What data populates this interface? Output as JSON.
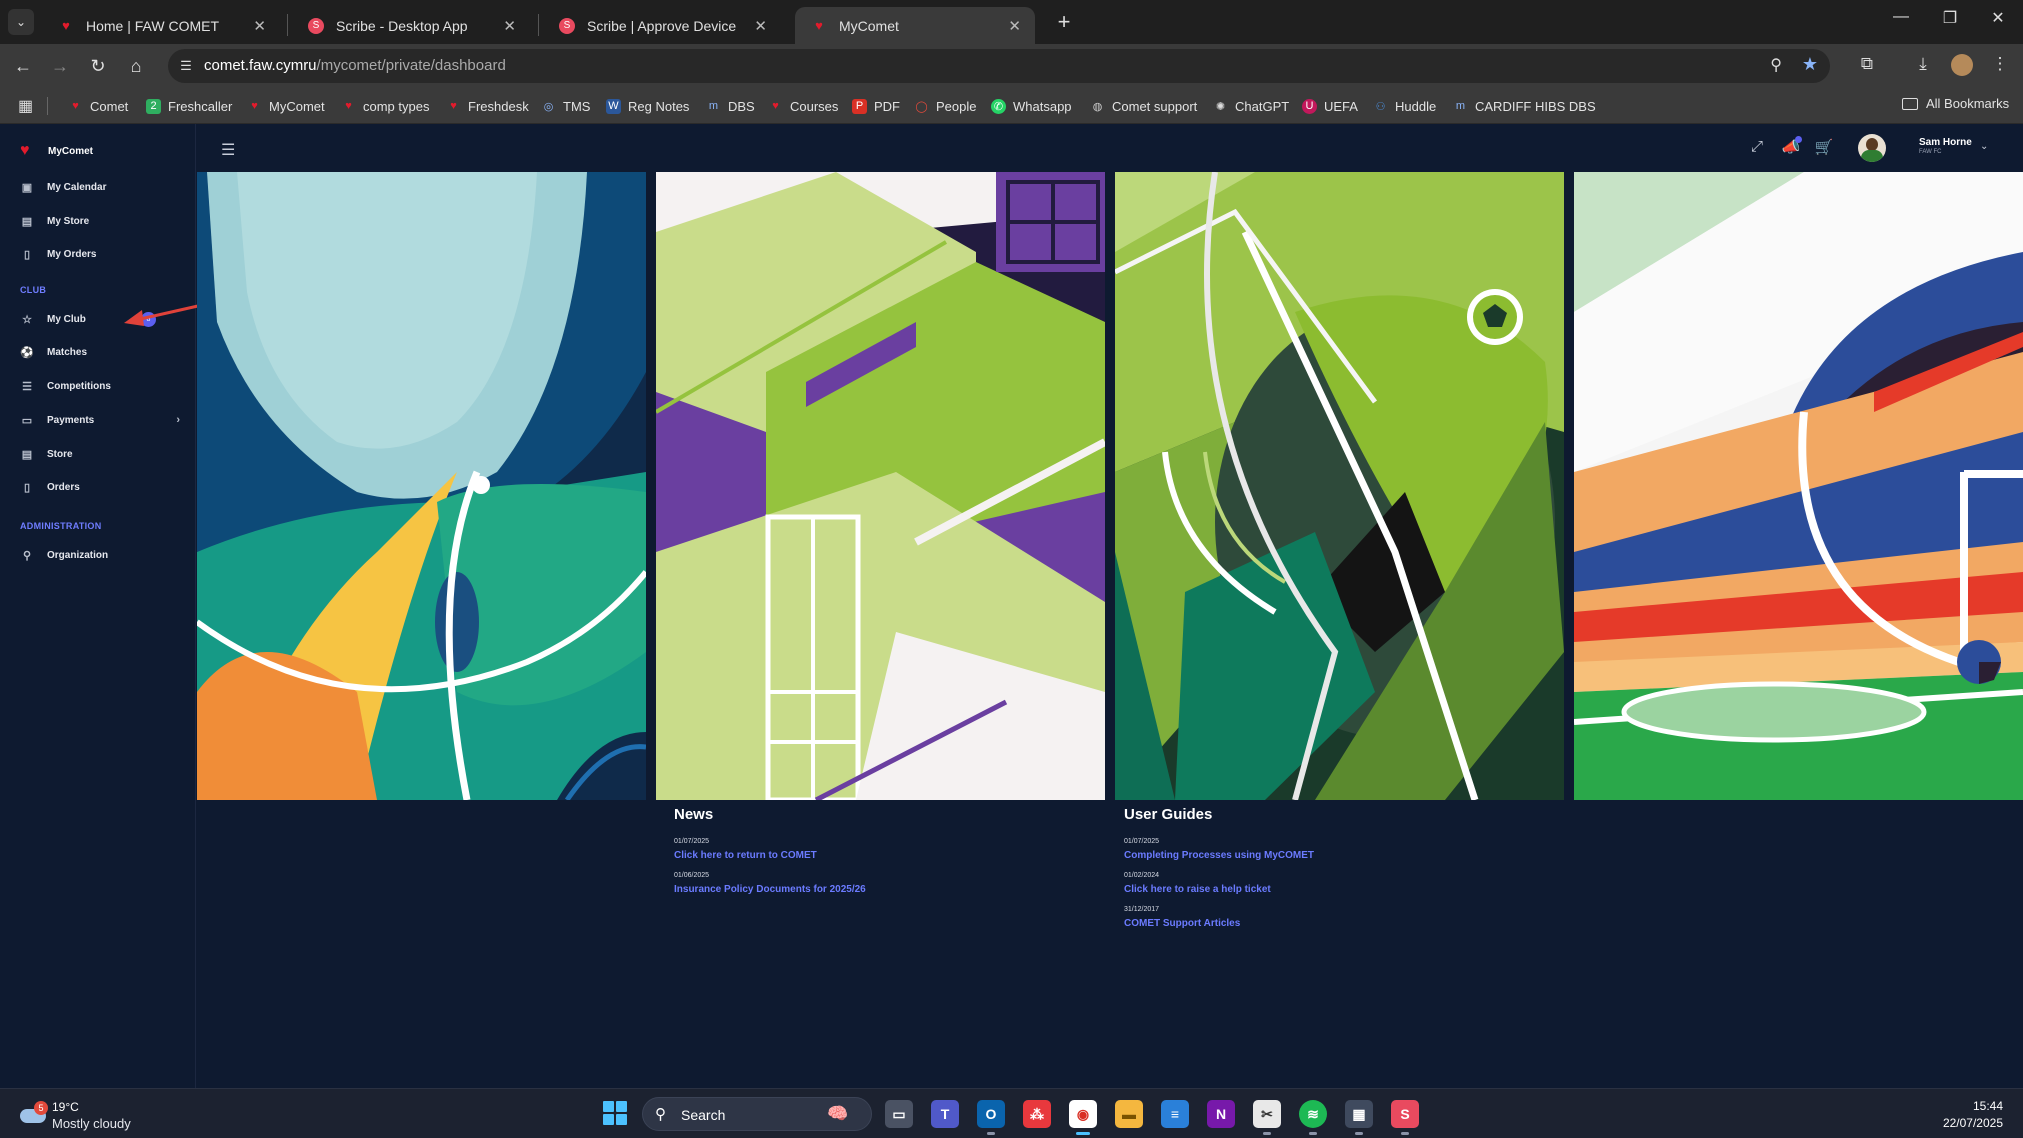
{
  "browser": {
    "tabs": [
      {
        "title": "Home | FAW COMET",
        "active": false
      },
      {
        "title": "Scribe - Desktop App",
        "active": false
      },
      {
        "title": "Scribe | Approve Device",
        "active": false
      },
      {
        "title": "MyComet",
        "active": true
      }
    ],
    "url_host": "comet.faw.cymru",
    "url_path": "/mycomet/private/dashboard",
    "bookmarks": [
      "Comet",
      "Freshcaller",
      "MyComet",
      "comp types",
      "Freshdesk",
      "TMS",
      "Reg Notes",
      "DBS",
      "Courses",
      "PDF",
      "People",
      "Whatsapp",
      "Comet support",
      "ChatGPT",
      "UEFA",
      "Huddle",
      "CARDIFF HIBS DBS"
    ],
    "all_bookmarks": "All Bookmarks"
  },
  "sidebar": {
    "brand": "MyComet",
    "items_top": [
      {
        "label": "My Calendar",
        "icon": "calendar-icon"
      },
      {
        "label": "My Store",
        "icon": "store-icon"
      },
      {
        "label": "My Orders",
        "icon": "document-icon"
      }
    ],
    "section_club": "CLUB",
    "items_club": [
      {
        "label": "My Club",
        "icon": "star-icon",
        "badge": "8"
      },
      {
        "label": "Matches",
        "icon": "football-icon"
      },
      {
        "label": "Competitions",
        "icon": "list-icon"
      },
      {
        "label": "Payments",
        "icon": "card-icon"
      },
      {
        "label": "Store",
        "icon": "store-icon"
      },
      {
        "label": "Orders",
        "icon": "document-icon"
      }
    ],
    "section_admin": "ADMINISTRATION",
    "items_admin": [
      {
        "label": "Organization",
        "icon": "hierarchy-icon"
      }
    ]
  },
  "user": {
    "name": "Sam Horne",
    "club": "FAW FC"
  },
  "news": {
    "title": "News",
    "items": [
      {
        "date": "01/07/2025",
        "link": "Click here to return to COMET"
      },
      {
        "date": "01/06/2025",
        "link": "Insurance Policy Documents for 2025/26"
      }
    ]
  },
  "guides": {
    "title": "User Guides",
    "items": [
      {
        "date": "01/07/2025",
        "link": "Completing Processes using MyCOMET"
      },
      {
        "date": "01/02/2024",
        "link": "Click here to raise a help ticket"
      },
      {
        "date": "31/12/2017",
        "link": "COMET Support Articles"
      }
    ]
  },
  "taskbar": {
    "weather_badge": "5",
    "temperature": "19°C",
    "weather": "Mostly cloudy",
    "search": "Search",
    "time": "15:44",
    "date": "22/07/2025"
  },
  "colors": {
    "app_bg": "#0e1a30",
    "accent": "#6b7bff",
    "brand_red": "#e21b2c"
  }
}
